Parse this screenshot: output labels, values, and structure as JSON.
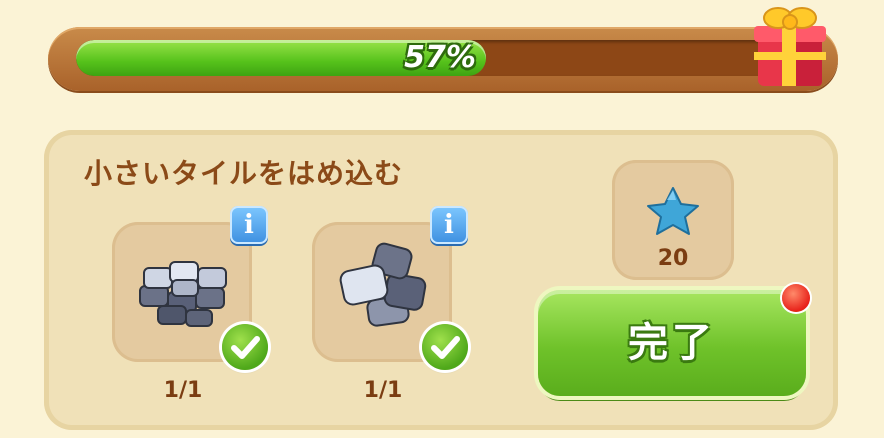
{
  "progress": {
    "value": 0.57,
    "label": "57%"
  },
  "task": {
    "title": "小さいタイルをはめ込む",
    "items": [
      {
        "icon": "stone-tiles-icon",
        "count": "1/1",
        "complete": true
      },
      {
        "icon": "stone-slabs-icon",
        "count": "1/1",
        "complete": true
      }
    ],
    "info_label": "i"
  },
  "reward": {
    "icon": "blue-star-icon",
    "amount": "20"
  },
  "done_button": {
    "label": "完了"
  },
  "colors": {
    "accent_green": "#6fc22a",
    "bar_brown": "#a9622a",
    "panel": "#f0e1b8"
  }
}
